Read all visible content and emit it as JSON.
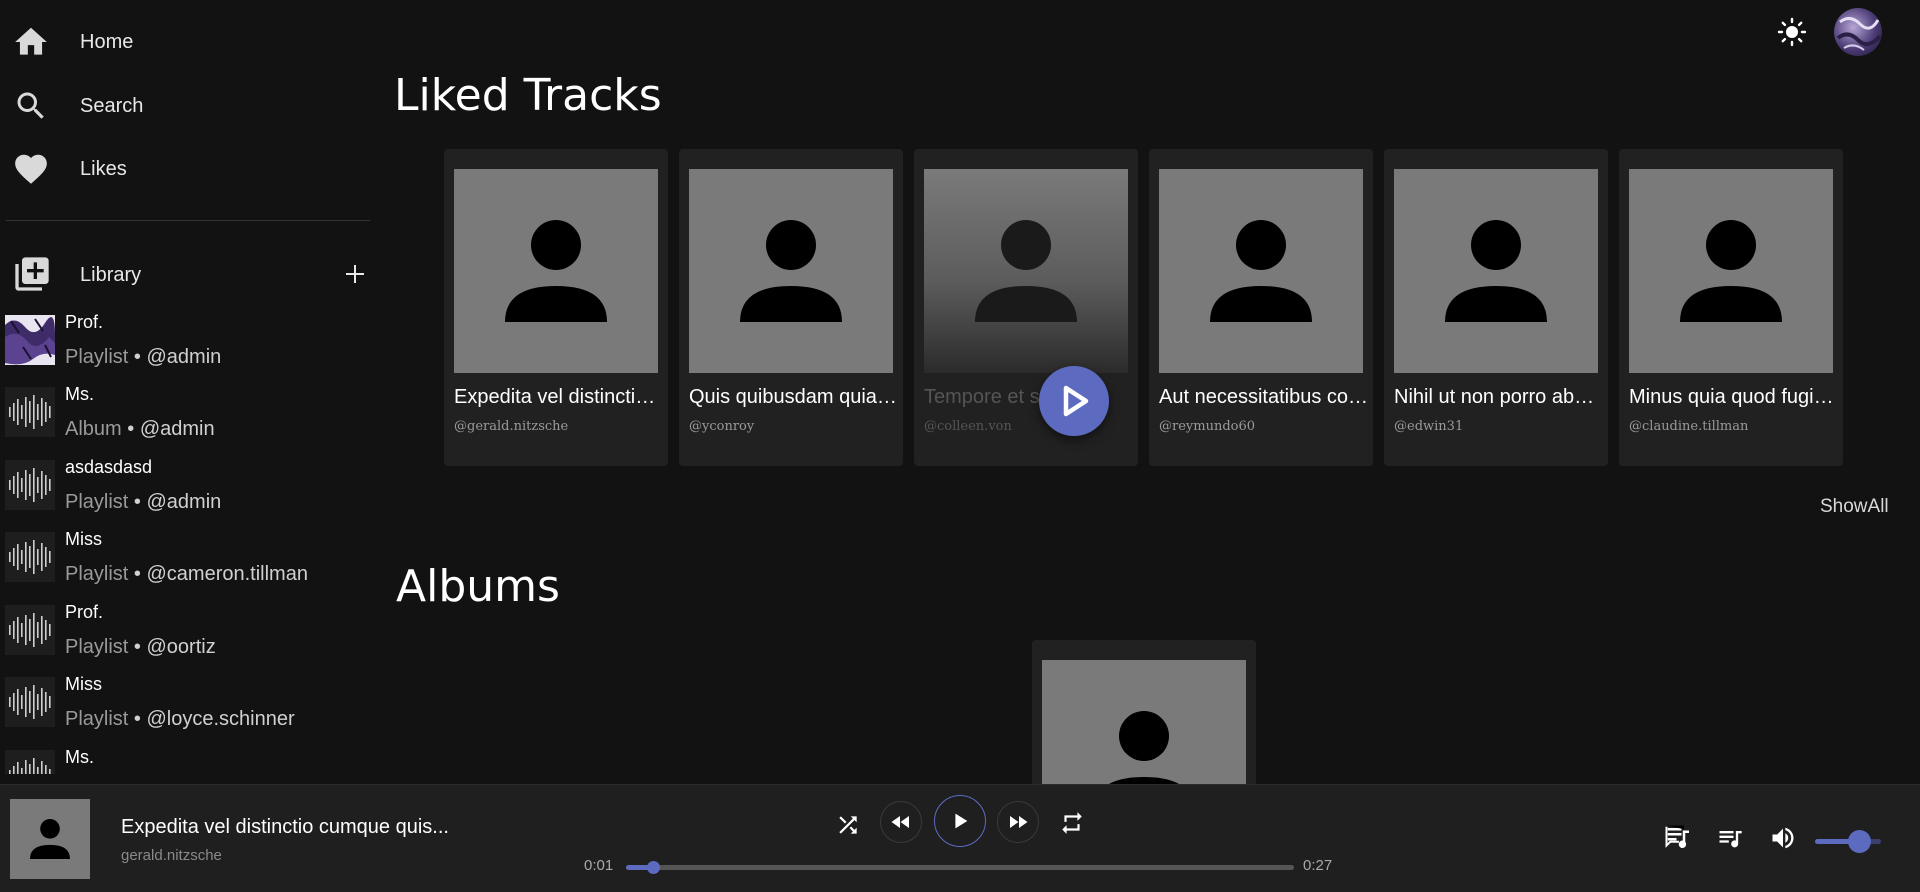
{
  "sidebar": {
    "nav": [
      {
        "label": "Home",
        "icon": "home-icon"
      },
      {
        "label": "Search",
        "icon": "search-icon"
      },
      {
        "label": "Likes",
        "icon": "heart-icon"
      }
    ],
    "library_label": "Library",
    "items": [
      {
        "name": "Prof.",
        "kind": "Playlist",
        "owner": "• @admin",
        "thumb": "pattern"
      },
      {
        "name": "Ms.",
        "kind": "Album",
        "owner": "• @admin",
        "thumb": "waveform"
      },
      {
        "name": "asdasdasd",
        "kind": "Playlist",
        "owner": "• @admin",
        "thumb": "waveform"
      },
      {
        "name": "Miss",
        "kind": "Playlist",
        "owner": "• @cameron.tillman",
        "thumb": "waveform"
      },
      {
        "name": "Prof.",
        "kind": "Playlist",
        "owner": "• @oortiz",
        "thumb": "waveform"
      },
      {
        "name": "Miss",
        "kind": "Playlist",
        "owner": "• @loyce.schinner",
        "thumb": "waveform"
      },
      {
        "name": "Ms.",
        "kind": "",
        "owner": "",
        "thumb": "waveform"
      }
    ]
  },
  "main": {
    "liked_title": "Liked Tracks",
    "liked_tracks": [
      {
        "title": "Expedita vel distinctio cumque quis…",
        "artist": "@gerald.nitzsche"
      },
      {
        "title": "Quis quibusdam quia…",
        "artist": "@yconroy"
      },
      {
        "title": "Tempore et s…",
        "artist": "@colleen.von"
      },
      {
        "title": "Aut necessitatibus consequatur",
        "artist": "@reymundo60"
      },
      {
        "title": "Nihil ut non porro ab…",
        "artist": "@edwin31"
      },
      {
        "title": "Minus quia quod fugit…",
        "artist": "@claudine.tillman"
      }
    ],
    "show_all": "ShowAll",
    "albums_title": "Albums"
  },
  "player": {
    "title": "Expedita vel distinctio cumque quis...",
    "artist": "gerald.nitzsche",
    "elapsed": "0:01",
    "duration": "0:27",
    "progress_fraction": 0.04,
    "volume_fraction": 0.67
  },
  "colors": {
    "accent": "#5c6bc0",
    "background": "#121212",
    "card": "#212121"
  }
}
